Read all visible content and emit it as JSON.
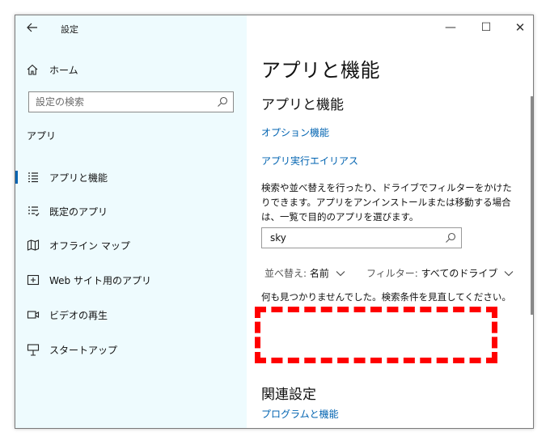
{
  "window": {
    "title": "設定",
    "back_icon": "arrow-left-icon",
    "controls": {
      "minimize": "—",
      "maximize": "☐",
      "close": "✕"
    }
  },
  "sidebar": {
    "home_label": "ホーム",
    "search_placeholder": "設定の検索",
    "section_label": "アプリ",
    "items": [
      {
        "label": "アプリと機能",
        "icon": "list-icon",
        "selected": true
      },
      {
        "label": "既定のアプリ",
        "icon": "list-check-icon",
        "selected": false
      },
      {
        "label": "オフライン マップ",
        "icon": "map-icon",
        "selected": false
      },
      {
        "label": "Web サイト用のアプリ",
        "icon": "web-app-icon",
        "selected": false
      },
      {
        "label": "ビデオの再生",
        "icon": "video-icon",
        "selected": false
      },
      {
        "label": "スタートアップ",
        "icon": "startup-icon",
        "selected": false
      }
    ]
  },
  "main": {
    "page_title": "アプリと機能",
    "subtitle": "アプリと機能",
    "links": {
      "optional_features": "オプション機能",
      "execution_alias": "アプリ実行エイリアス"
    },
    "description": "検索や並べ替えを行ったり、ドライブでフィルターをかけたりできます。アプリをアンインストールまたは移動する場合は、一覧で目的のアプリを選びます。",
    "app_search": {
      "value": "sky"
    },
    "sort": {
      "label": "並べ替え:",
      "value": "名前"
    },
    "filter": {
      "label": "フィルター:",
      "value": "すべてのドライブ"
    },
    "no_result_text": "何も見つかりませんでした。検索条件を見直してください。",
    "related_title": "関連設定",
    "related_links": {
      "programs": "プログラムと機能"
    }
  },
  "colors": {
    "accent": "#0063b1",
    "sidebar_bg": "#eefbfe",
    "highlight": "#ff0000"
  }
}
